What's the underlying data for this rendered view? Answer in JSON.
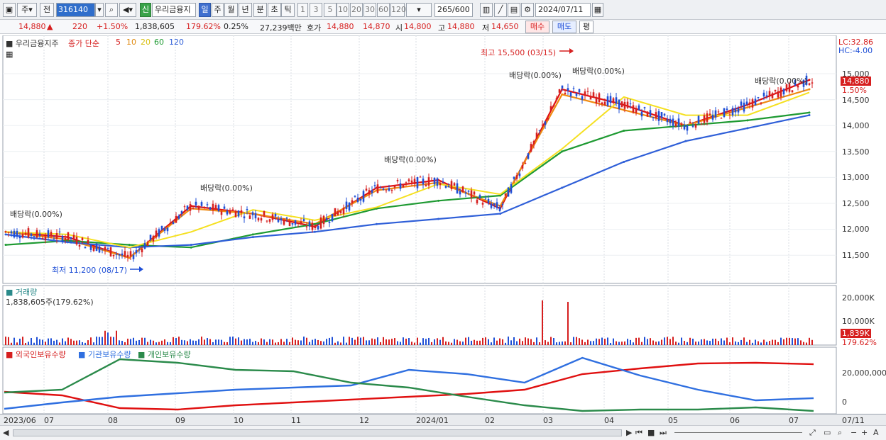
{
  "toolbar": {
    "market": "주",
    "market2": "전",
    "code": "316140",
    "badge": "신",
    "name": "우리금융지",
    "periods": [
      "일",
      "주",
      "월",
      "년",
      "분",
      "초",
      "틱"
    ],
    "selected_period": "일",
    "nums": [
      "1",
      "3",
      "5",
      "10",
      "20",
      "30",
      "60",
      "120"
    ],
    "count": "265",
    "count_total": "/600",
    "date": "2024/07/11"
  },
  "quote": {
    "price": "14,880",
    "change": "220",
    "change_pct": "+1.50%",
    "volume": "1,838,605",
    "vol_ratio": "179.62%",
    "turnover": "0.25%",
    "amount": "27,239백만",
    "hoga_label": "호가",
    "hoga_sell": "14,880",
    "hoga_buy": "14,870",
    "open_label": "시",
    "open": "14,800",
    "high_label": "고",
    "high": "14,880",
    "low_label": "저",
    "low": "14,650",
    "buy_btn": "매수",
    "sell_btn": "매도",
    "eval_btn": "평"
  },
  "price_panel": {
    "title": "우리금융지주",
    "legend_label": "종가 단순",
    "ma_labels": [
      "5",
      "10",
      "20",
      "60",
      "120"
    ],
    "lc": "LC:32.86",
    "hc": "HC:-4.00",
    "last_price_tag": "14,880",
    "last_pct_tag": "1.50%",
    "high_annot": "최고 15,500 (03/15)",
    "low_annot": "최저 11,200 (08/17)",
    "dividend_label": "배당락(0.00%)",
    "y_ticks": [
      "15,000",
      "14,500",
      "14,000",
      "13,500",
      "13,000",
      "12,500",
      "12,000",
      "11,500"
    ]
  },
  "volume_panel": {
    "title": "거래량",
    "value": "1,838,605주(179.62%)",
    "y_ticks": [
      "20,000K",
      "10,000K"
    ],
    "last_tag": "1,839K",
    "last_pct": "179.62%"
  },
  "holding_panel": {
    "legend": [
      "외국인보유수량",
      "기관보유수량",
      "개인보유수량"
    ],
    "y_ticks": [
      "20,000,000",
      "0"
    ]
  },
  "x_axis": [
    "2023/06",
    "07",
    "08",
    "09",
    "10",
    "11",
    "12",
    "2024/01",
    "02",
    "03",
    "04",
    "05",
    "06",
    "07",
    "07/11"
  ],
  "colors": {
    "up": "#d61f1f",
    "down": "#1f4fd6",
    "ma5": "#e01010",
    "ma10": "#f08a10",
    "ma20": "#f5e020",
    "ma60": "#1e9a32",
    "ma120": "#2f5fd8",
    "foreign": "#e01010",
    "institution": "#2f6fe0",
    "individual": "#2a8a4a"
  },
  "chart_data": {
    "type": "line",
    "x": [
      "2023/06",
      "07",
      "08",
      "09",
      "10",
      "11",
      "12",
      "2024/01",
      "02",
      "03",
      "04",
      "05",
      "06",
      "07"
    ],
    "ylim": [
      11200,
      15500
    ],
    "series": [
      {
        "name": "종가",
        "values": [
          11950,
          11850,
          11450,
          12450,
          12300,
          12050,
          12800,
          12950,
          12400,
          14700,
          14400,
          14000,
          14400,
          14880
        ]
      },
      {
        "name": "5",
        "values": [
          11950,
          11800,
          11450,
          12400,
          12300,
          12100,
          12750,
          12900,
          12450,
          14600,
          14300,
          14000,
          14350,
          14700
        ]
      },
      {
        "name": "60",
        "values": [
          11700,
          11780,
          11700,
          11650,
          11900,
          12100,
          12400,
          12550,
          12650,
          13500,
          13900,
          14000,
          14100,
          14250
        ]
      },
      {
        "name": "120",
        "values": [
          11900,
          11750,
          11650,
          11700,
          11850,
          11950,
          12100,
          12200,
          12300,
          12800,
          13300,
          13700,
          13950,
          14200
        ]
      }
    ]
  }
}
